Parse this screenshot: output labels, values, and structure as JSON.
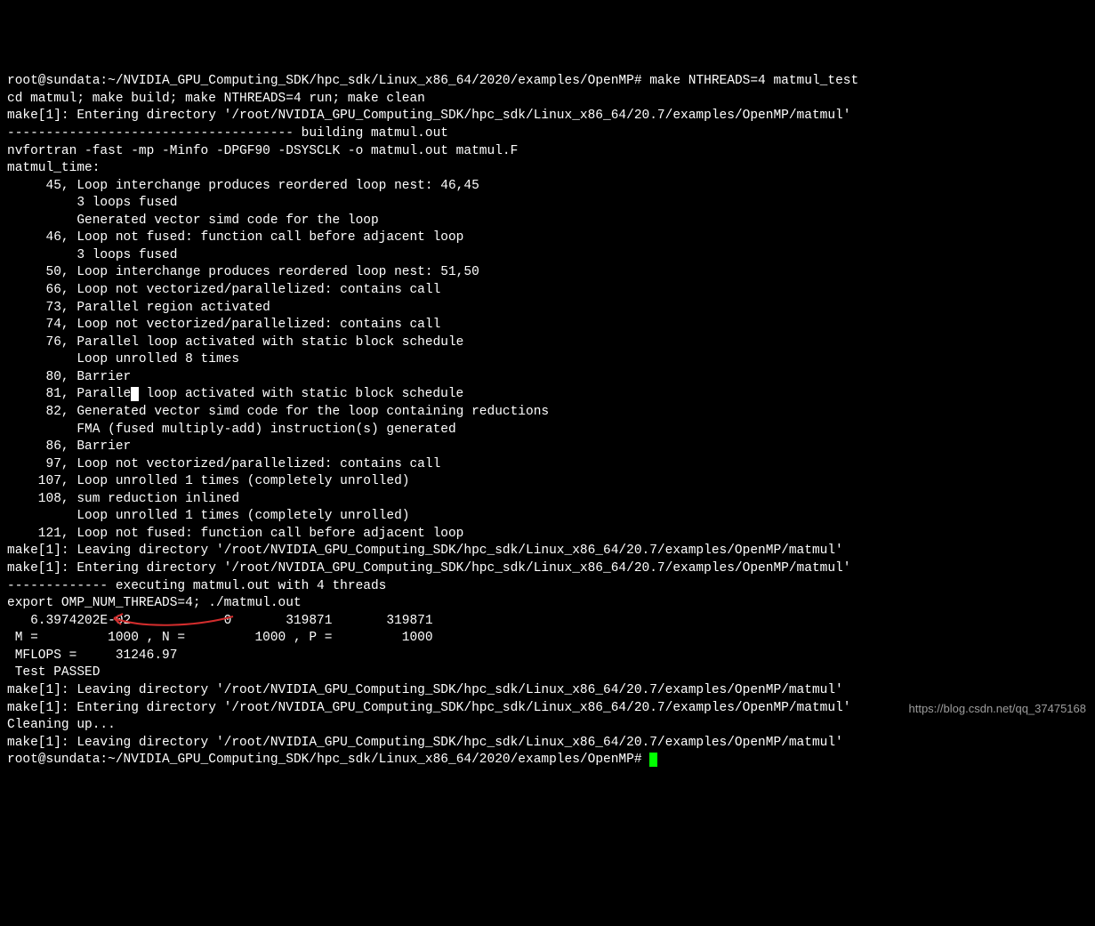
{
  "prompt1": {
    "user_host": "root@sundata",
    "path": "~/NVIDIA_GPU_Computing_SDK/hpc_sdk/Linux_x86_64/2020/examples/OpenMP",
    "symbol": "#",
    "command": "make NTHREADS=4 matmul_test"
  },
  "lines": [
    "cd matmul; make build; make NTHREADS=4 run; make clean",
    "make[1]: Entering directory '/root/NVIDIA_GPU_Computing_SDK/hpc_sdk/Linux_x86_64/20.7/examples/OpenMP/matmul'",
    "------------------------------------- building matmul.out",
    "nvfortran -fast -mp -Minfo -DPGF90 -DSYSCLK -o matmul.out matmul.F",
    "matmul_time:",
    "     45, Loop interchange produces reordered loop nest: 46,45",
    "         3 loops fused",
    "         Generated vector simd code for the loop",
    "     46, Loop not fused: function call before adjacent loop",
    "         3 loops fused",
    "     50, Loop interchange produces reordered loop nest: 51,50",
    "     66, Loop not vectorized/parallelized: contains call",
    "     73, Parallel region activated",
    "     74, Loop not vectorized/parallelized: contains call",
    "     76, Parallel loop activated with static block schedule",
    "         Loop unrolled 8 times",
    "     80, Barrier"
  ],
  "line81_a": "     81, Paralle",
  "line81_b": " loop activated with static block schedule",
  "lines2": [
    "     82, Generated vector simd code for the loop containing reductions",
    "         FMA (fused multiply-add) instruction(s) generated",
    "     86, Barrier",
    "     97, Loop not vectorized/parallelized: contains call",
    "    107, Loop unrolled 1 times (completely unrolled)",
    "    108, sum reduction inlined",
    "         Loop unrolled 1 times (completely unrolled)",
    "    121, Loop not fused: function call before adjacent loop",
    "make[1]: Leaving directory '/root/NVIDIA_GPU_Computing_SDK/hpc_sdk/Linux_x86_64/20.7/examples/OpenMP/matmul'",
    "make[1]: Entering directory '/root/NVIDIA_GPU_Computing_SDK/hpc_sdk/Linux_x86_64/20.7/examples/OpenMP/matmul'",
    "------------- executing matmul.out with 4 threads",
    "export OMP_NUM_THREADS=4; ./matmul.out",
    "   6.3974202E-02            0       319871       319871",
    " M =         1000 , N =         1000 , P =         1000",
    " MFLOPS =     31246.97",
    " Test PASSED",
    "make[1]: Leaving directory '/root/NVIDIA_GPU_Computing_SDK/hpc_sdk/Linux_x86_64/20.7/examples/OpenMP/matmul'",
    "make[1]: Entering directory '/root/NVIDIA_GPU_Computing_SDK/hpc_sdk/Linux_x86_64/20.7/examples/OpenMP/matmul'",
    "Cleaning up...",
    "make[1]: Leaving directory '/root/NVIDIA_GPU_Computing_SDK/hpc_sdk/Linux_x86_64/20.7/examples/OpenMP/matmul'"
  ],
  "prompt2": {
    "user_host": "root@sundata",
    "path": "~/NVIDIA_GPU_Computing_SDK/hpc_sdk/Linux_x86_64/2020/examples/OpenMP",
    "symbol": "#"
  },
  "watermark": "https://blog.csdn.net/qq_37475168"
}
